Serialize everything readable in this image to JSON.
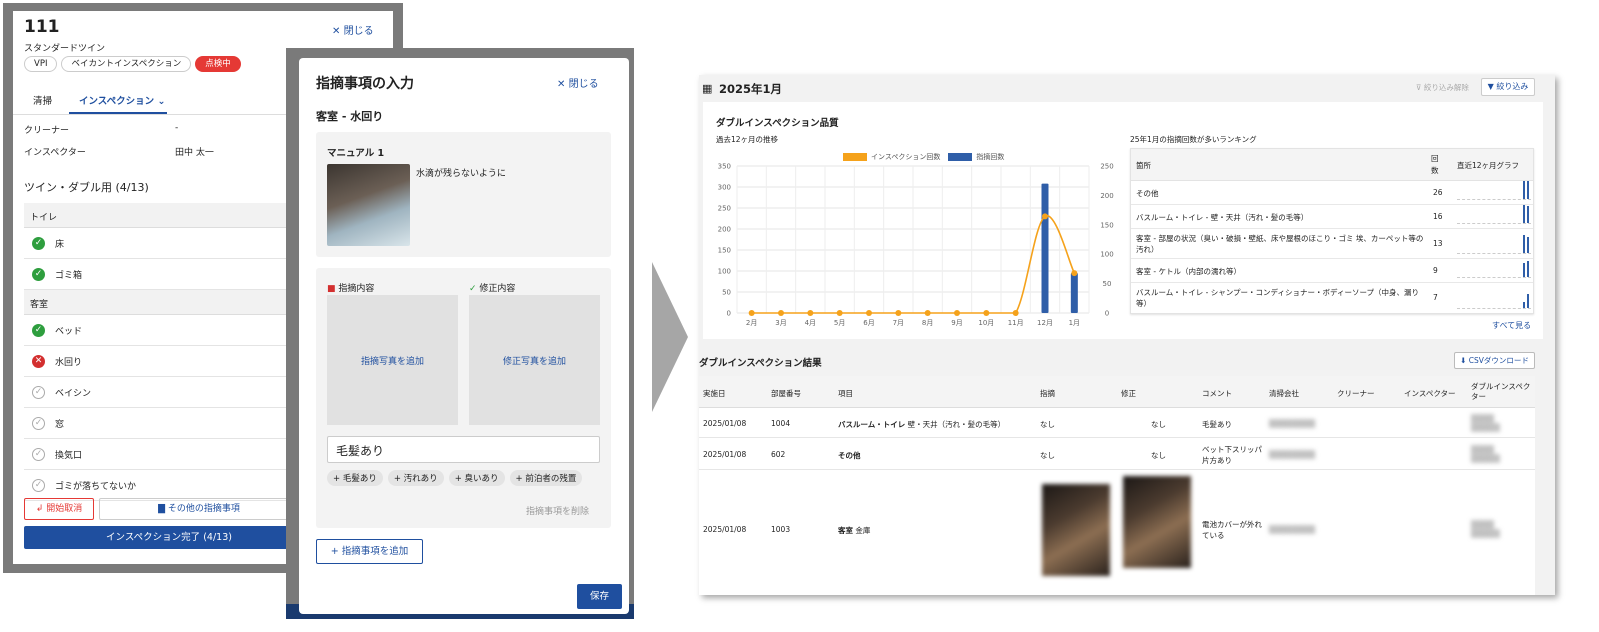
{
  "left_panel": {
    "room_number": "111",
    "room_type": "スタンダードツイン",
    "close_label": "閉じる",
    "badges": [
      "VPI",
      "ベイカントインスペクション",
      "点検中"
    ],
    "tabs": [
      "清掃",
      "インスペクション"
    ],
    "fields": [
      {
        "label": "クリーナー",
        "value": "-"
      },
      {
        "label": "インスペクター",
        "value": "田中 太一"
      }
    ],
    "section_title": "ツイン・ダブル用 (4/13)",
    "groups": [
      {
        "name": "トイレ",
        "items": [
          {
            "label": "床",
            "status": "ok"
          },
          {
            "label": "ゴミ箱",
            "status": "ok"
          }
        ]
      },
      {
        "name": "客室",
        "items": [
          {
            "label": "ベッド",
            "status": "ok"
          },
          {
            "label": "水回り",
            "status": "ng"
          },
          {
            "label": "ベイシン",
            "status": "none"
          },
          {
            "label": "窓",
            "status": "none"
          },
          {
            "label": "換気口",
            "status": "none"
          },
          {
            "label": "ゴミが落ちてないか",
            "status": "none"
          }
        ]
      }
    ],
    "cancel_label": "開始取消",
    "other_issue_label": "その他の指摘事項",
    "complete_label": "インスペクション完了 (4/13)"
  },
  "issue_modal": {
    "title": "指摘事項の入力",
    "close_label": "閉じる",
    "subtitle": "客室 - 水回り",
    "manual_title": "マニュアル 1",
    "manual_text": "水滴が残らないように",
    "issue_label": "指摘内容",
    "fix_label": "修正内容",
    "add_issue_photo": "指摘写真を追加",
    "add_fix_photo": "修正写真を追加",
    "input_value": "毛髪あり",
    "chips": [
      "毛髪あり",
      "汚れあり",
      "臭いあり",
      "前泊者の残置"
    ],
    "delete_label": "指摘事項を削除",
    "add_label": "指摘事項を追加",
    "save_label": "保存"
  },
  "dashboard": {
    "month": "2025年1月",
    "filter_clear_label": "絞り込み解除",
    "filter_label": "絞り込み",
    "card_title": "ダブルインスペクション品質",
    "chart_subtitle": "過去12ヶ月の推移",
    "ranking_subtitle": "25年1月の指摘回数が多いランキング",
    "ranking_headers": {
      "place": "箇所",
      "count": "回数",
      "graph": "直近12ヶ月グラフ"
    },
    "ranking": [
      {
        "place": "その他",
        "count": "26"
      },
      {
        "place": "バスルーム・トイレ - 壁・天井（汚れ・髪の毛等）",
        "count": "16"
      },
      {
        "place": "客室 - 部屋の状況（臭い・破損・壁紙、床や屋根のほこり・ゴミ 埃、カーペット等の汚れ）",
        "count": "13"
      },
      {
        "place": "客室 - ケトル（内部の濡れ等）",
        "count": "9"
      },
      {
        "place": "バスルーム・トイレ - シャンプー・コンディショナー・ボディーソープ（中身、漏り等）",
        "count": "7"
      }
    ],
    "see_all_label": "すべて見る",
    "results_title": "ダブルインスペクション結果",
    "csv_label": "CSVダウンロード",
    "result_headers": [
      "実施日",
      "部屋番号",
      "項目",
      "指摘",
      "修正",
      "コメント",
      "清掃会社",
      "クリーナー",
      "インスペクター",
      "ダブルインスペクター"
    ],
    "results": [
      {
        "date": "2025/01/08",
        "room": "1004",
        "item_bold": "バスルーム・トイレ",
        "item_rest": "壁・天井（汚れ・髪の毛等）",
        "issue": "なし",
        "fix": "なし",
        "comment": "毛髪あり"
      },
      {
        "date": "2025/01/08",
        "room": "602",
        "item_bold": "その他",
        "item_rest": "",
        "issue": "なし",
        "fix": "なし",
        "comment": "ベット下スリッパ片方あり"
      },
      {
        "date": "2025/01/08",
        "room": "1003",
        "item_bold": "客室",
        "item_rest": "金庫",
        "issue": "",
        "fix": "",
        "comment": "電池カバーが外れている"
      }
    ]
  },
  "chart_data": {
    "type": "bar",
    "title": "",
    "categories": [
      "2月",
      "3月",
      "4月",
      "5月",
      "6月",
      "7月",
      "8月",
      "9月",
      "10月",
      "11月",
      "12月",
      "1月"
    ],
    "series": [
      {
        "name": "インスペクション回数",
        "type": "line",
        "axis": "left",
        "color": "#f5a21b",
        "values": [
          0,
          0,
          0,
          0,
          0,
          0,
          0,
          0,
          0,
          0,
          230,
          95
        ]
      },
      {
        "name": "指摘回数",
        "type": "bar",
        "axis": "right",
        "color": "#2f5ea8",
        "values": [
          0,
          0,
          0,
          0,
          0,
          0,
          0,
          0,
          0,
          0,
          220,
          68
        ]
      }
    ],
    "y_left_ticks": [
      "0",
      "50",
      "100",
      "150",
      "200",
      "250",
      "300",
      "350"
    ],
    "y_right_ticks": [
      "0",
      "50",
      "100",
      "150",
      "200",
      "250"
    ],
    "ylim_left": [
      0,
      350
    ],
    "ylim_right": [
      0,
      250
    ],
    "grid": true,
    "legend": "top"
  }
}
